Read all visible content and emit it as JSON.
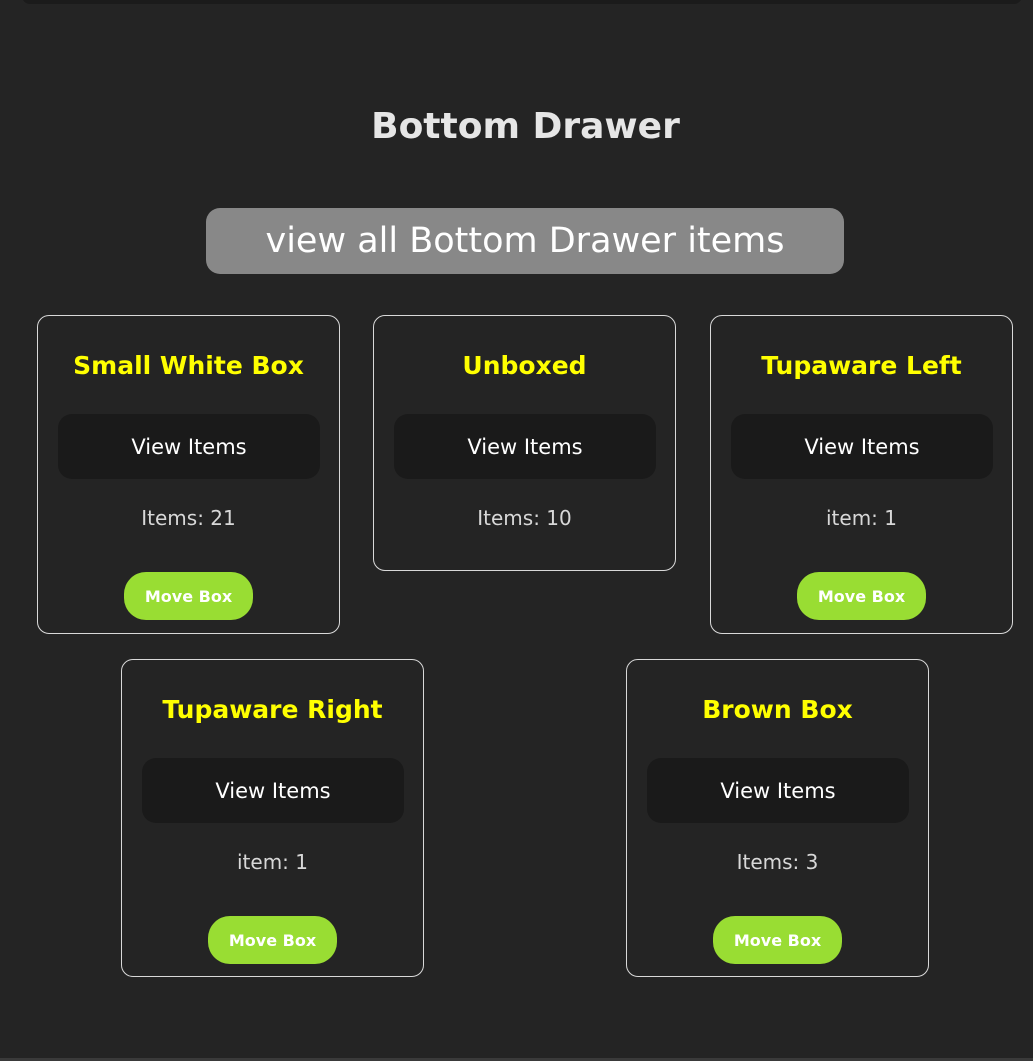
{
  "page": {
    "title": "Bottom Drawer",
    "view_all_label": "view all Bottom Drawer items"
  },
  "boxes": [
    {
      "name": "Small White Box",
      "view_label": "View Items",
      "count_text": "Items: 21",
      "move_label": "Move Box"
    },
    {
      "name": "Unboxed",
      "view_label": "View Items",
      "count_text": "Items: 10"
    },
    {
      "name": "Tupaware Left",
      "view_label": "View Items",
      "count_text": "item: 1",
      "move_label": "Move Box"
    },
    {
      "name": "Tupaware Right",
      "view_label": "View Items",
      "count_text": "item: 1",
      "move_label": "Move Box"
    },
    {
      "name": "Brown Box",
      "view_label": "View Items",
      "count_text": "Items: 3",
      "move_label": "Move Box"
    }
  ],
  "colors": {
    "background": "#242424",
    "title_yellow": "#ffff00",
    "move_green": "#99dd33",
    "view_all_gray": "#888888"
  }
}
